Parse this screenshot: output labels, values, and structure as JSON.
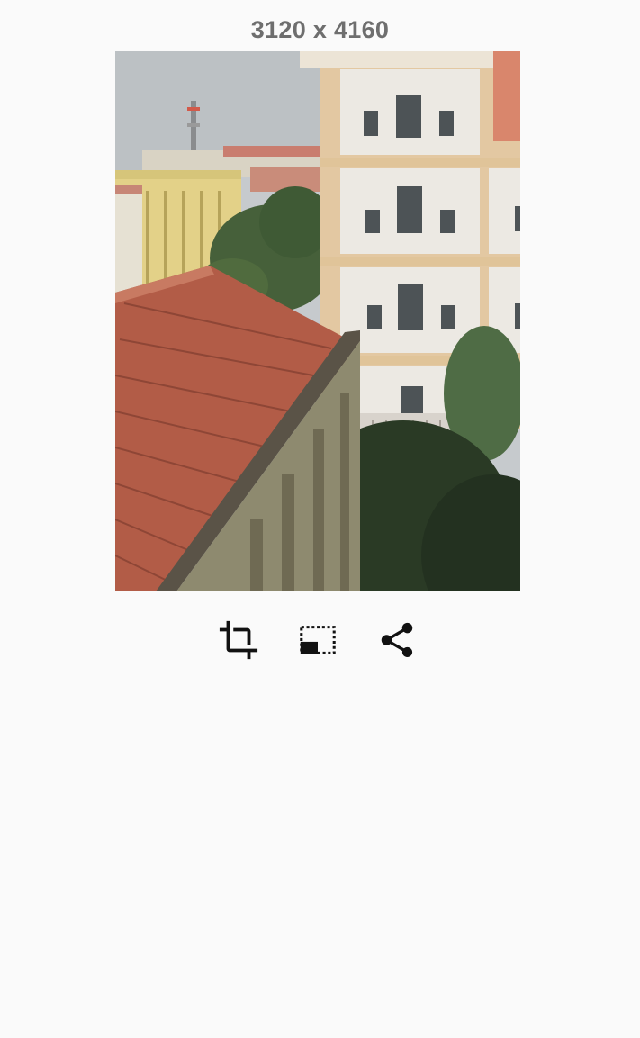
{
  "image": {
    "dimensions_label": "3120 x 4160",
    "description_icon": "photo-of-buildings-and-tiled-roof"
  },
  "toolbar": {
    "actions": [
      {
        "icon": "crop-icon"
      },
      {
        "icon": "resize-icon"
      },
      {
        "icon": "share-icon"
      }
    ]
  },
  "colors": {
    "background": "#fafafa",
    "label": "#6e6e6e",
    "icon": "#111111"
  }
}
